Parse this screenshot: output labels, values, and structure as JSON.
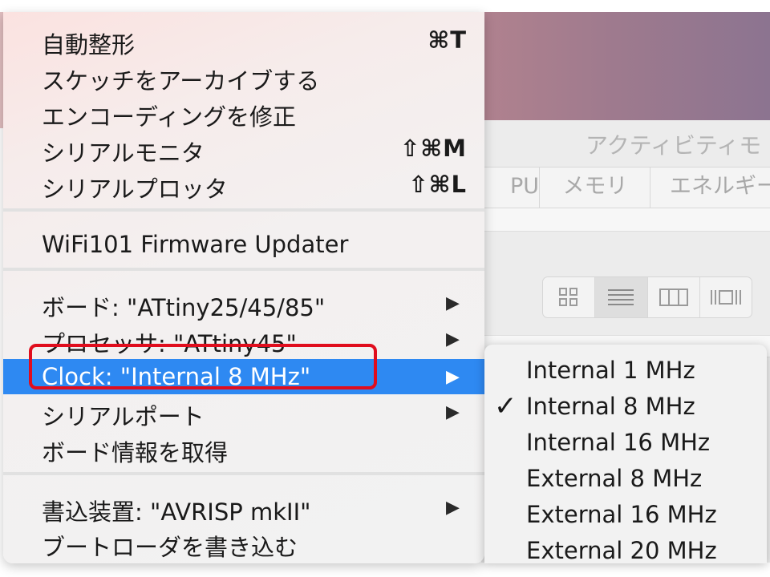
{
  "background_window": {
    "title": "アクティビティモ",
    "tabs": [
      "PU",
      "メモリ",
      "エネルギー"
    ]
  },
  "menu": {
    "items": [
      {
        "label": "自動整形",
        "shortcut": "⌘T"
      },
      {
        "label": "スケッチをアーカイブする",
        "shortcut": ""
      },
      {
        "label": "エンコーディングを修正",
        "shortcut": ""
      },
      {
        "label": "シリアルモニタ",
        "shortcut": "⇧⌘M"
      },
      {
        "label": "シリアルプロッタ",
        "shortcut": "⇧⌘L"
      },
      {
        "label": "WiFi101 Firmware Updater",
        "shortcut": ""
      },
      {
        "label": "ボード: \"ATtiny25/45/85\"",
        "shortcut": ""
      },
      {
        "label": "プロセッサ: \"ATtiny45\"",
        "shortcut": ""
      },
      {
        "label": "Clock: \"Internal 8 MHz\"",
        "shortcut": ""
      },
      {
        "label": "シリアルポート",
        "shortcut": ""
      },
      {
        "label": "ボード情報を取得",
        "shortcut": ""
      },
      {
        "label": "書込装置: \"AVRISP mkII\"",
        "shortcut": ""
      },
      {
        "label": "ブートローダを書き込む",
        "shortcut": ""
      }
    ],
    "highlighted_index": 8,
    "arrow": "▶"
  },
  "submenu": {
    "checkmark": "✓",
    "selected_index": 1,
    "items": [
      "Internal 1 MHz",
      "Internal 8 MHz",
      "Internal 16 MHz",
      "External 8 MHz",
      "External 16 MHz",
      "External 20 MHz"
    ]
  },
  "colors": {
    "highlight": "#2e89f2",
    "annotation_box": "#e00d1d"
  }
}
